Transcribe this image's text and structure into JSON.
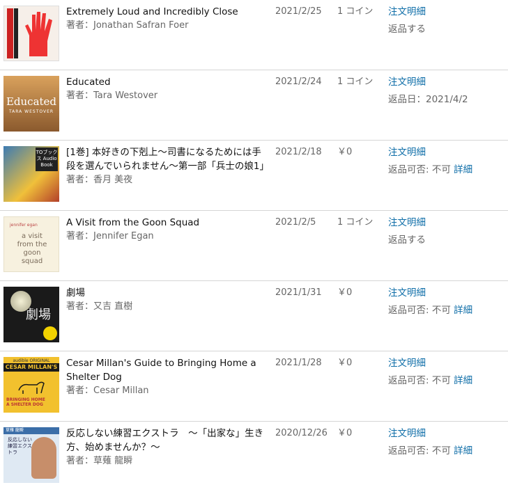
{
  "orders": [
    {
      "title": "Extremely Loud and Incredibly Close",
      "author": "著者：Jonathan Safran Foer",
      "date": "2021/2/25",
      "price": "1 コイン",
      "detail_link": "注文明細",
      "action_link": "返品する",
      "cover": "extremely-loud-cover"
    },
    {
      "title": "Educated",
      "author": "著者：Tara Westover",
      "date": "2021/2/24",
      "price": "1 コイン",
      "detail_link": "注文明細",
      "return_text": "返品日：2021/4/2",
      "cover": "educated-cover",
      "cover_text": "Educated",
      "cover_sub": "TARA WESTOVER"
    },
    {
      "title": "[1巻] 本好きの下剋上～司書になるためには手段を選んでいられません～第一部「兵士の娘1」",
      "author": "著者：香月 美夜",
      "date": "2021/2/18",
      "price": "￥0",
      "detail_link": "注文明細",
      "return_label": "返品可否: 不可",
      "return_detail": "詳細",
      "cover": "honzuki-cover",
      "cover_badge": "TOブックス Audio Book"
    },
    {
      "title": "A Visit from the Goon Squad",
      "author": "著者：Jennifer Egan",
      "date": "2021/2/5",
      "price": "1 コイン",
      "detail_link": "注文明細",
      "action_link": "返品する",
      "cover": "goon-squad-cover",
      "cover_top": "jennifer egan",
      "cover_big": "a visit from the goon squad"
    },
    {
      "title": "劇場",
      "author": "著者：又吉 直樹",
      "date": "2021/1/31",
      "price": "￥0",
      "detail_link": "注文明細",
      "return_label": "返品可否: 不可",
      "return_detail": "詳細",
      "cover": "gekijo-cover",
      "cover_text": "劇場"
    },
    {
      "title": "Cesar Millan's Guide to Bringing Home a Shelter Dog",
      "author": "著者：Cesar Millan",
      "date": "2021/1/28",
      "price": "￥0",
      "detail_link": "注文明細",
      "return_label": "返品可否: 不可",
      "return_detail": "詳細",
      "cover": "cesar-millan-cover",
      "cover_top": "audible ORIGINAL",
      "cover_name": "CESAR MILLAN'S",
      "cover_bot": "BRINGING HOME A SHELTER DOG"
    },
    {
      "title": "反応しない練習エクストラ　～「出家な」生き方、始めませんか？～",
      "author": "著者：草薙 龍瞬",
      "date": "2020/12/26",
      "price": "￥0",
      "detail_link": "注文明細",
      "return_label": "返品可否: 不可",
      "return_detail": "詳細",
      "cover": "hannou-cover",
      "cover_hdr": "草薙 龍瞬",
      "cover_vt": "反応しない練習エクストラ"
    }
  ],
  "colors": {
    "link": "#0f6ea8",
    "muted": "#666666",
    "divider": "#d5d5d5"
  }
}
